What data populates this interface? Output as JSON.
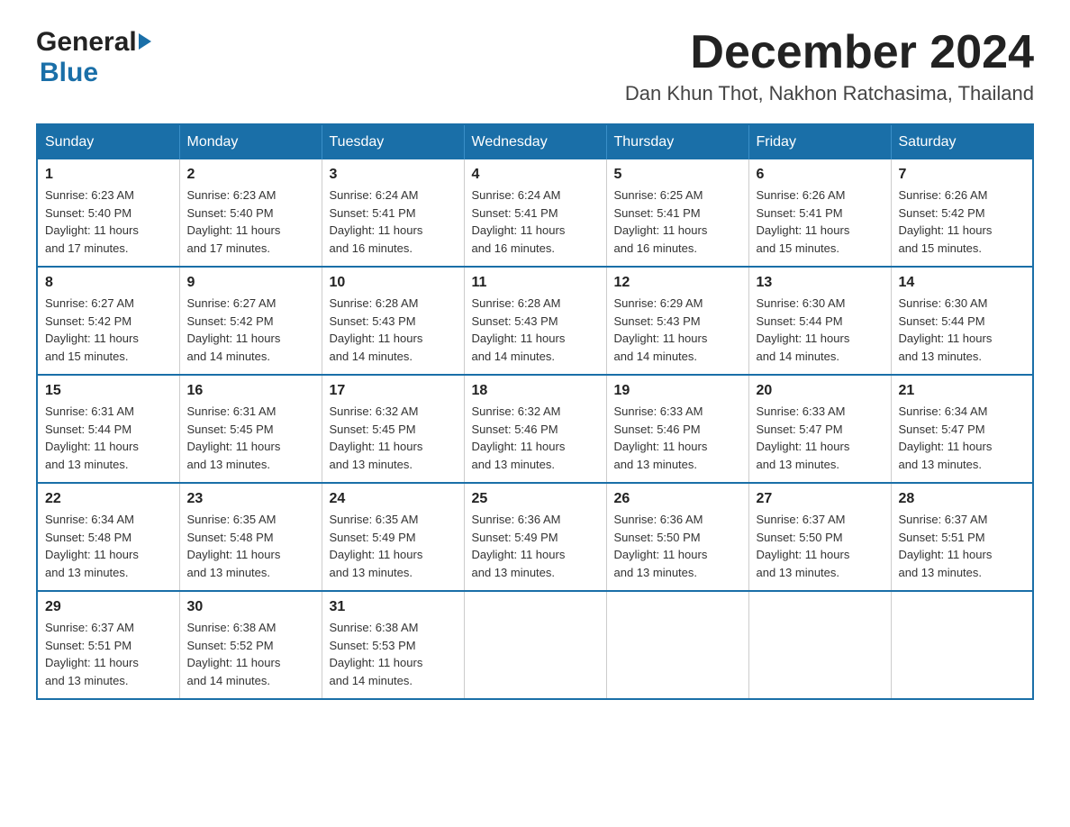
{
  "header": {
    "logo_general": "General",
    "logo_blue": "Blue",
    "month_title": "December 2024",
    "location": "Dan Khun Thot, Nakhon Ratchasima, Thailand"
  },
  "weekdays": [
    "Sunday",
    "Monday",
    "Tuesday",
    "Wednesday",
    "Thursday",
    "Friday",
    "Saturday"
  ],
  "weeks": [
    [
      {
        "day": "1",
        "sunrise": "6:23 AM",
        "sunset": "5:40 PM",
        "daylight": "11 hours and 17 minutes."
      },
      {
        "day": "2",
        "sunrise": "6:23 AM",
        "sunset": "5:40 PM",
        "daylight": "11 hours and 17 minutes."
      },
      {
        "day": "3",
        "sunrise": "6:24 AM",
        "sunset": "5:41 PM",
        "daylight": "11 hours and 16 minutes."
      },
      {
        "day": "4",
        "sunrise": "6:24 AM",
        "sunset": "5:41 PM",
        "daylight": "11 hours and 16 minutes."
      },
      {
        "day": "5",
        "sunrise": "6:25 AM",
        "sunset": "5:41 PM",
        "daylight": "11 hours and 16 minutes."
      },
      {
        "day": "6",
        "sunrise": "6:26 AM",
        "sunset": "5:41 PM",
        "daylight": "11 hours and 15 minutes."
      },
      {
        "day": "7",
        "sunrise": "6:26 AM",
        "sunset": "5:42 PM",
        "daylight": "11 hours and 15 minutes."
      }
    ],
    [
      {
        "day": "8",
        "sunrise": "6:27 AM",
        "sunset": "5:42 PM",
        "daylight": "11 hours and 15 minutes."
      },
      {
        "day": "9",
        "sunrise": "6:27 AM",
        "sunset": "5:42 PM",
        "daylight": "11 hours and 14 minutes."
      },
      {
        "day": "10",
        "sunrise": "6:28 AM",
        "sunset": "5:43 PM",
        "daylight": "11 hours and 14 minutes."
      },
      {
        "day": "11",
        "sunrise": "6:28 AM",
        "sunset": "5:43 PM",
        "daylight": "11 hours and 14 minutes."
      },
      {
        "day": "12",
        "sunrise": "6:29 AM",
        "sunset": "5:43 PM",
        "daylight": "11 hours and 14 minutes."
      },
      {
        "day": "13",
        "sunrise": "6:30 AM",
        "sunset": "5:44 PM",
        "daylight": "11 hours and 14 minutes."
      },
      {
        "day": "14",
        "sunrise": "6:30 AM",
        "sunset": "5:44 PM",
        "daylight": "11 hours and 13 minutes."
      }
    ],
    [
      {
        "day": "15",
        "sunrise": "6:31 AM",
        "sunset": "5:44 PM",
        "daylight": "11 hours and 13 minutes."
      },
      {
        "day": "16",
        "sunrise": "6:31 AM",
        "sunset": "5:45 PM",
        "daylight": "11 hours and 13 minutes."
      },
      {
        "day": "17",
        "sunrise": "6:32 AM",
        "sunset": "5:45 PM",
        "daylight": "11 hours and 13 minutes."
      },
      {
        "day": "18",
        "sunrise": "6:32 AM",
        "sunset": "5:46 PM",
        "daylight": "11 hours and 13 minutes."
      },
      {
        "day": "19",
        "sunrise": "6:33 AM",
        "sunset": "5:46 PM",
        "daylight": "11 hours and 13 minutes."
      },
      {
        "day": "20",
        "sunrise": "6:33 AM",
        "sunset": "5:47 PM",
        "daylight": "11 hours and 13 minutes."
      },
      {
        "day": "21",
        "sunrise": "6:34 AM",
        "sunset": "5:47 PM",
        "daylight": "11 hours and 13 minutes."
      }
    ],
    [
      {
        "day": "22",
        "sunrise": "6:34 AM",
        "sunset": "5:48 PM",
        "daylight": "11 hours and 13 minutes."
      },
      {
        "day": "23",
        "sunrise": "6:35 AM",
        "sunset": "5:48 PM",
        "daylight": "11 hours and 13 minutes."
      },
      {
        "day": "24",
        "sunrise": "6:35 AM",
        "sunset": "5:49 PM",
        "daylight": "11 hours and 13 minutes."
      },
      {
        "day": "25",
        "sunrise": "6:36 AM",
        "sunset": "5:49 PM",
        "daylight": "11 hours and 13 minutes."
      },
      {
        "day": "26",
        "sunrise": "6:36 AM",
        "sunset": "5:50 PM",
        "daylight": "11 hours and 13 minutes."
      },
      {
        "day": "27",
        "sunrise": "6:37 AM",
        "sunset": "5:50 PM",
        "daylight": "11 hours and 13 minutes."
      },
      {
        "day": "28",
        "sunrise": "6:37 AM",
        "sunset": "5:51 PM",
        "daylight": "11 hours and 13 minutes."
      }
    ],
    [
      {
        "day": "29",
        "sunrise": "6:37 AM",
        "sunset": "5:51 PM",
        "daylight": "11 hours and 13 minutes."
      },
      {
        "day": "30",
        "sunrise": "6:38 AM",
        "sunset": "5:52 PM",
        "daylight": "11 hours and 14 minutes."
      },
      {
        "day": "31",
        "sunrise": "6:38 AM",
        "sunset": "5:53 PM",
        "daylight": "11 hours and 14 minutes."
      },
      null,
      null,
      null,
      null
    ]
  ],
  "labels": {
    "sunrise": "Sunrise:",
    "sunset": "Sunset:",
    "daylight": "Daylight:"
  }
}
